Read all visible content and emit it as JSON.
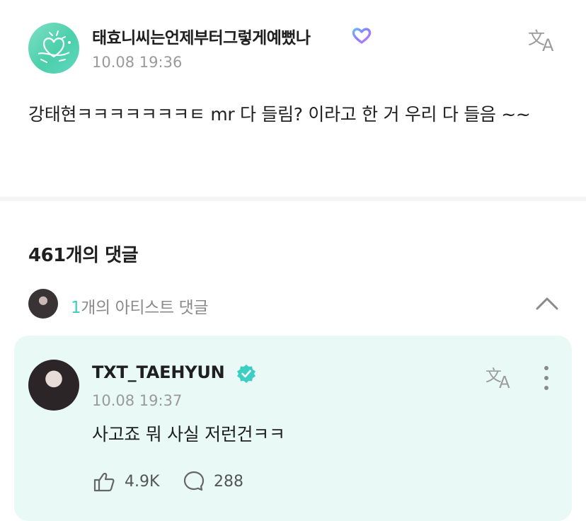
{
  "post": {
    "author": "태효니씨는언제부터그렇게예뻤나",
    "timestamp": "10.08 19:36",
    "body": "강태현ㅋㅋㅋㅋㅋㅋㅋㅌ mr 다 들림? 이라고 한 거 우리 다 들음 ~~",
    "avatar_icon": "doodle-avatar-icon",
    "badge_icon": "fan-heart-badge-icon",
    "translate_icon": "translate-icon"
  },
  "comments": {
    "count_label": "461개의 댓글",
    "artist_row": {
      "count": "1",
      "label": "개의 아티스트 댓글",
      "toggle_icon": "chevron-up-icon"
    }
  },
  "artist_comment": {
    "author": "TXT_TAEHYUN",
    "timestamp": "10.08 19:37",
    "body": "사고죠 뭐 사실 저런건ㅋㅋ",
    "likes": "4.9K",
    "replies": "288",
    "verified_icon": "verified-check-icon",
    "like_icon": "like-hand-icon",
    "reply_icon": "speech-bubble-icon",
    "more_icon": "more-vertical-icon"
  },
  "colors": {
    "accent": "#3bcfc4",
    "card_background": "#e9faf6",
    "muted_text": "#9a9a9a"
  }
}
